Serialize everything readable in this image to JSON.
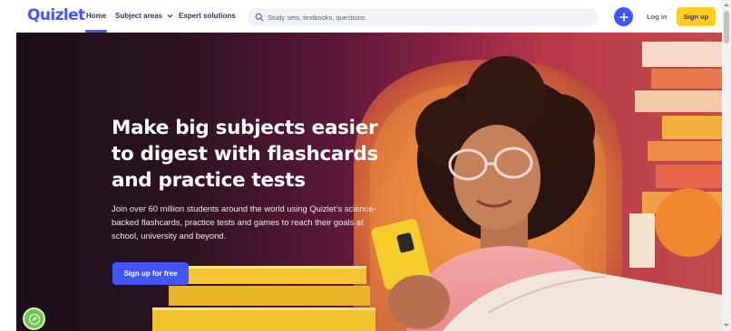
{
  "header": {
    "logo": "Quizlet",
    "nav": {
      "home": "Home",
      "subject_areas": "Subject areas",
      "expert_solutions": "Expert solutions"
    },
    "search": {
      "placeholder": "Study sets, textbooks, questions",
      "value": ""
    },
    "create_icon": "plus-icon",
    "login_label": "Log in",
    "signup_label": "Sign up"
  },
  "hero": {
    "headline": "Make big subjects easier to digest with flashcards and practice tests",
    "subtext": "Join over 60 million students around the world using Quizlet’s science-backed flashcards, practice tests and games to reach their goals at school, university and beyond.",
    "cta_label": "Sign up for free"
  },
  "colors": {
    "brand": "#4255ff",
    "signup": "#ffcd1f",
    "badge": "#6fc44a"
  },
  "badge_icon": "recycle-leaf-icon"
}
